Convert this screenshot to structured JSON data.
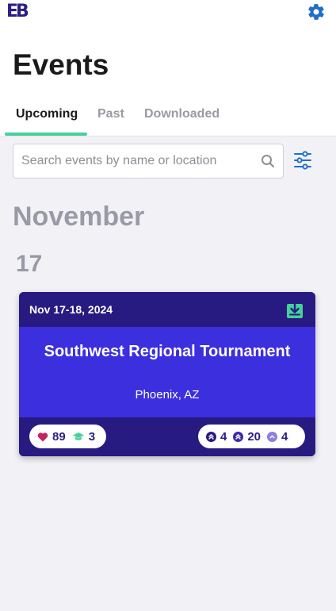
{
  "app": {
    "logo_text": "EB",
    "gear_icon": "gear-icon"
  },
  "page": {
    "title": "Events"
  },
  "tabs": [
    {
      "label": "Upcoming",
      "active": true
    },
    {
      "label": "Past",
      "active": false
    },
    {
      "label": "Downloaded",
      "active": false
    }
  ],
  "search": {
    "placeholder": "Search events by name or location",
    "value": ""
  },
  "events_group": {
    "month": "November",
    "day": "17"
  },
  "event": {
    "date": "Nov 17-18, 2024",
    "name": "Southwest Regional Tournament",
    "location": "Phoenix, AZ",
    "likes": "89",
    "grads": "3",
    "stat_a": "4",
    "stat_b": "20",
    "stat_c": "4"
  },
  "colors": {
    "brand": "#2b1f86",
    "accent": "#45d19a",
    "card_dark": "#271b82",
    "card_mid": "#3c2fde",
    "link_blue": "#1f6fc9"
  }
}
